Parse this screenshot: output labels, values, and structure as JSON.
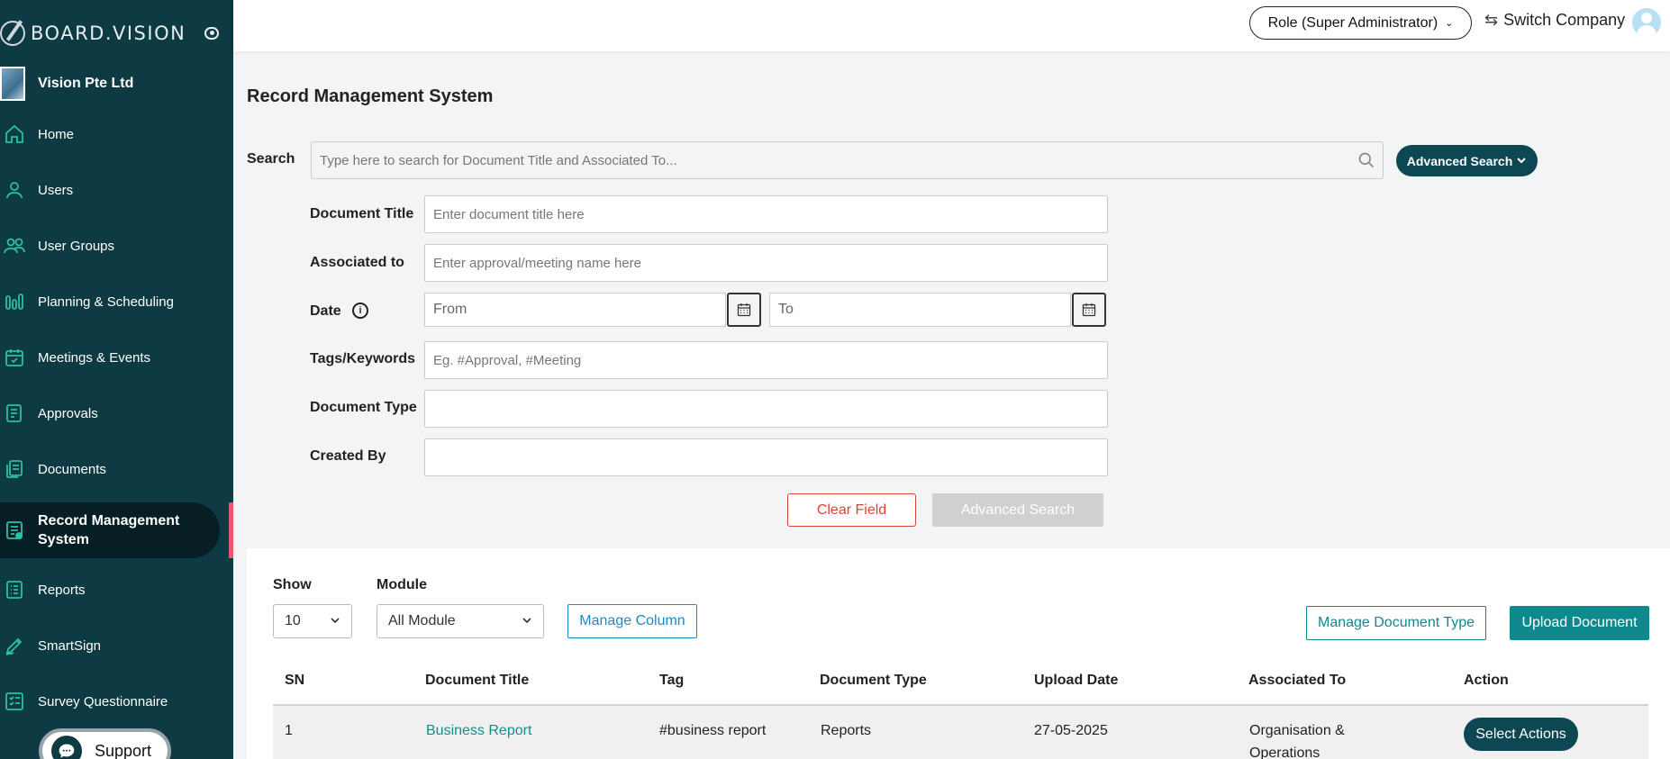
{
  "brand": {
    "name": "BOARD.VISION"
  },
  "company": {
    "name": "Vision Pte Ltd"
  },
  "sidebar": {
    "items": [
      {
        "label": "Home",
        "icon": "home-icon"
      },
      {
        "label": "Users",
        "icon": "user-icon"
      },
      {
        "label": "User Groups",
        "icon": "users-icon"
      },
      {
        "label": "Planning & Scheduling",
        "icon": "bar-chart-icon"
      },
      {
        "label": "Meetings & Events",
        "icon": "calendar-check-icon"
      },
      {
        "label": "Approvals",
        "icon": "approval-doc-icon"
      },
      {
        "label": "Documents",
        "icon": "documents-icon"
      },
      {
        "label": "Record Management System",
        "icon": "record-icon",
        "active": true
      },
      {
        "label": "Reports",
        "icon": "list-icon"
      },
      {
        "label": "SmartSign",
        "icon": "pen-icon"
      },
      {
        "label": "Survey Questionnaire",
        "icon": "checklist-icon"
      }
    ],
    "support_label": "Support"
  },
  "topbar": {
    "role_label": "Role (Super Administrator)",
    "switch_label": "Switch Company"
  },
  "page": {
    "title": "Record Management System"
  },
  "search": {
    "label": "Search",
    "placeholder": "Type here to search for Document Title and Associated To...",
    "advanced_label": "Advanced Search"
  },
  "advanced_form": {
    "document_title": {
      "label": "Document Title",
      "placeholder": "Enter document title here"
    },
    "associated_to": {
      "label": "Associated to",
      "placeholder": "Enter approval/meeting name here"
    },
    "date": {
      "label": "Date",
      "from_placeholder": "From",
      "to_placeholder": "To"
    },
    "tags": {
      "label": "Tags/Keywords",
      "placeholder": "Eg. #Approval, #Meeting"
    },
    "document_type": {
      "label": "Document Type",
      "value": ""
    },
    "created_by": {
      "label": "Created By",
      "value": ""
    },
    "clear_label": "Clear Field",
    "submit_label": "Advanced Search"
  },
  "table_controls": {
    "show_label": "Show",
    "show_value": "10",
    "module_label": "Module",
    "module_value": "All Module",
    "manage_column_label": "Manage Column",
    "manage_type_label": "Manage Document Type",
    "upload_label": "Upload Document"
  },
  "table": {
    "columns": [
      "SN",
      "Document Title",
      "Tag",
      "Document Type",
      "Upload Date",
      "Associated To",
      "Action"
    ],
    "rows": [
      {
        "sn": "1",
        "title": "Business Report",
        "tag": "#business report",
        "type": "Reports",
        "date": "27-05-2025",
        "associated": "Organisation & Operations",
        "action": "Select Actions"
      }
    ]
  },
  "colors": {
    "sidebar_bg": "#0e3a43",
    "accent_teal": "#0e8a8f",
    "primary_dark": "#0e4754",
    "danger": "#d9443a"
  }
}
